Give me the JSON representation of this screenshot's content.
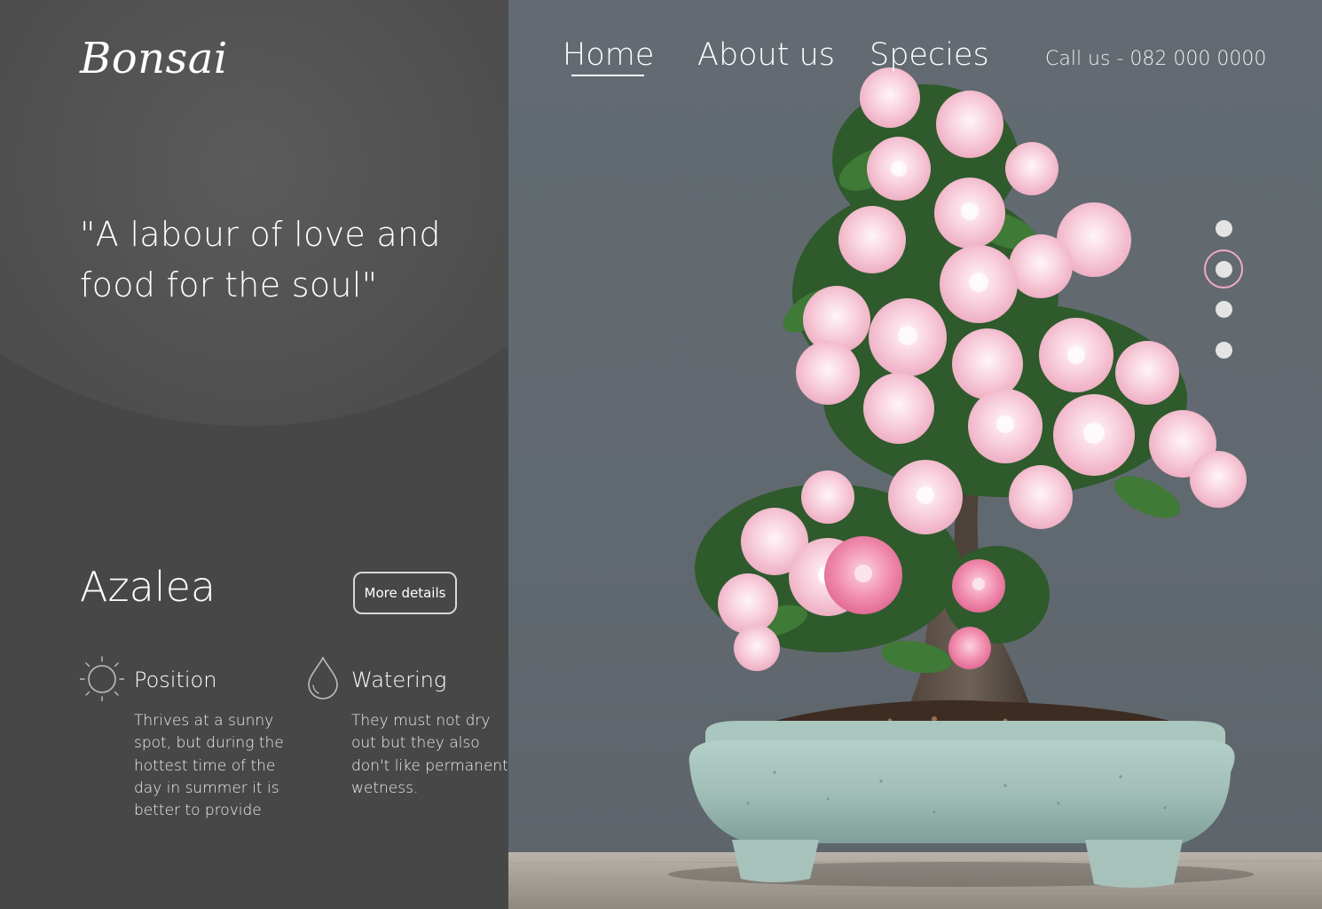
{
  "brand": {
    "logo": "Bonsai"
  },
  "hero": {
    "quote": "\"A labour of love and food for the soul\""
  },
  "nav": {
    "items": [
      {
        "label": "Home",
        "active": true
      },
      {
        "label": "About us",
        "active": false
      },
      {
        "label": "Species",
        "active": false
      }
    ],
    "call_us": "Call us - 082 000 0000"
  },
  "plant": {
    "name": "Azalea",
    "more_details_label": "More details",
    "position": {
      "title": "Position",
      "icon": "sun-icon",
      "text": "Thrives at a sunny spot, but during the hottest time of the day in summer it is better to provide"
    },
    "watering": {
      "title": "Watering",
      "icon": "water-drop-icon",
      "text": "They must not dry out but they also don't like permanent wetness."
    }
  },
  "slider": {
    "total": 4,
    "active_index": 2
  },
  "colors": {
    "panel": "#474747",
    "hero_background": "#616970",
    "active_ring": "#f2a9c4",
    "pot": "#9fbdb6",
    "blossom": "#f7c9d8"
  }
}
